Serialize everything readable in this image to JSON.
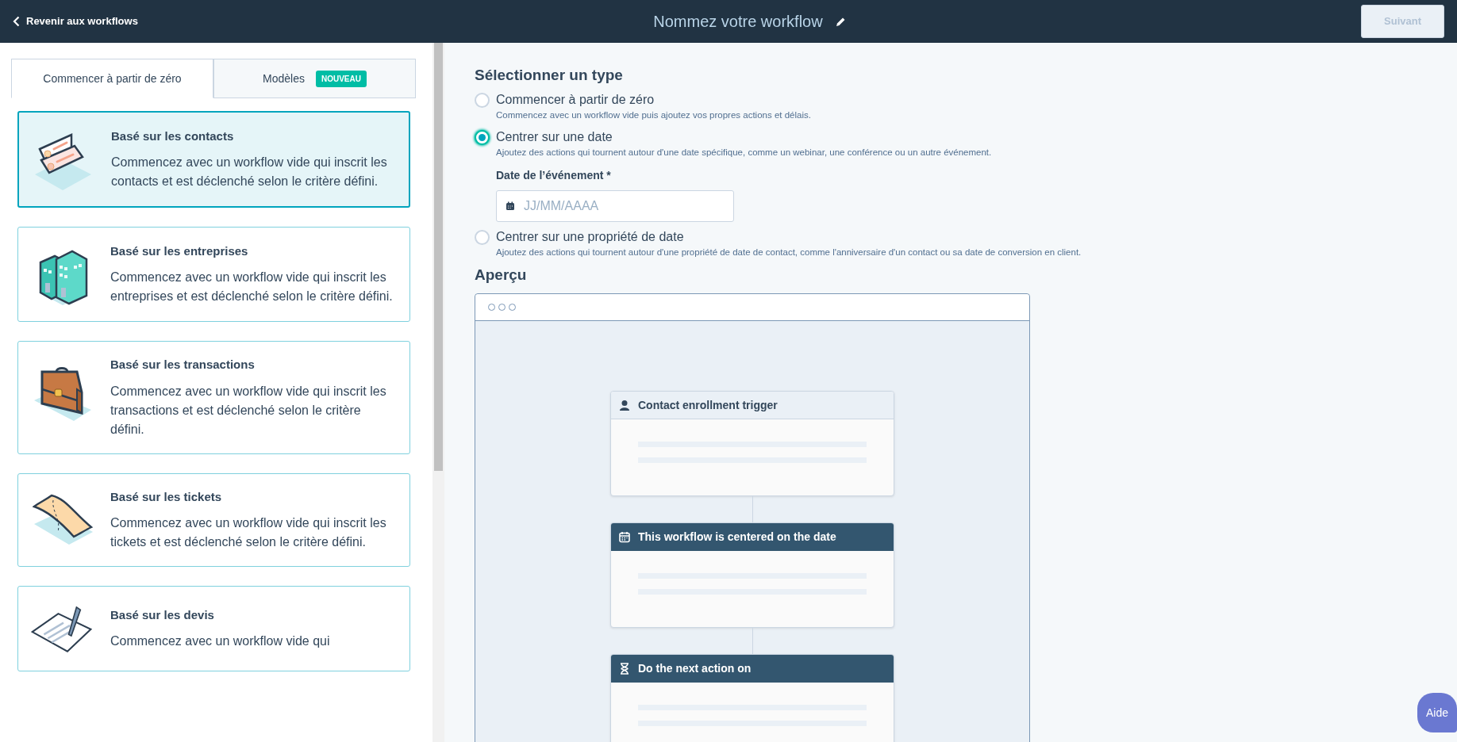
{
  "top_bar": {
    "back_link": "Revenir aux workflows",
    "title": "Nommez votre workflow",
    "next_button": {
      "label": "Suivant",
      "disabled": true
    }
  },
  "tabs": [
    {
      "label": "Commencer à partir de zéro",
      "selected": true
    },
    {
      "label": "Modèles",
      "badge": "NOUVEAU",
      "selected": false
    }
  ],
  "object_cards": [
    {
      "kind": "contacts",
      "title": "Basé sur les contacts",
      "description": "Commencez avec un workflow vide qui inscrit les contacts et est déclenché selon le critère défini.",
      "selected": true
    },
    {
      "kind": "companies",
      "title": "Basé sur les entreprises",
      "description": "Commencez avec un workflow vide qui inscrit les entreprises et est déclenché selon le critère défini.",
      "selected": false
    },
    {
      "kind": "deals",
      "title": "Basé sur les transactions",
      "description": "Commencez avec un workflow vide qui inscrit les transactions et est déclenché selon le critère défini.",
      "selected": false
    },
    {
      "kind": "tickets",
      "title": "Basé sur les tickets",
      "description": "Commencez avec un workflow vide qui inscrit les tickets et est déclenché selon le critère défini.",
      "selected": false
    },
    {
      "kind": "quotes",
      "title": "Basé sur les devis",
      "description": "Commencez avec un workflow vide qui",
      "selected": false
    }
  ],
  "type_section": {
    "heading": "Sélectionner un type",
    "options": [
      {
        "label": "Commencer à partir de zéro",
        "description": "Commencez avec un workflow vide puis ajoutez vos propres actions et délais.",
        "selected": false
      },
      {
        "label": "Centrer sur une date",
        "description": "Ajoutez des actions qui tournent autour d'une date spécifique, comme un webinar, une conférence ou un autre événement.",
        "selected": true,
        "date_field": {
          "label": "Date de l’événement *",
          "placeholder": "JJ/MM/AAAA"
        }
      },
      {
        "label": "Centrer sur une propriété de date",
        "description": "Ajoutez des actions qui tournent autour d'une propriété de date de contact, comme l'anniversaire d'un contact ou sa date de conversion en client.",
        "selected": false
      }
    ]
  },
  "preview": {
    "heading": "Aperçu",
    "nodes": [
      {
        "kind": "trigger",
        "title": "Contact enrollment trigger"
      },
      {
        "kind": "date",
        "title": "This workflow is centered on the date"
      },
      {
        "kind": "delay",
        "title": "Do the next action on"
      }
    ]
  },
  "help_button": "Aide"
}
